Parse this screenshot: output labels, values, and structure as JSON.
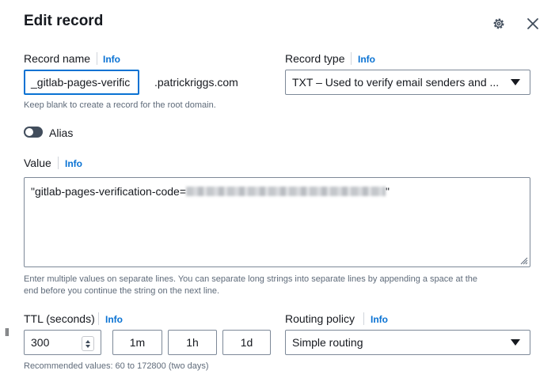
{
  "dialog": {
    "title": "Edit record",
    "settings_icon": "gear-icon",
    "close_icon": "close-icon"
  },
  "record_name": {
    "label": "Record name",
    "info": "Info",
    "value": "_gitlab-pages-verific",
    "domain_suffix": ".patrickriggs.com",
    "hint": "Keep blank to create a record for the root domain."
  },
  "record_type": {
    "label": "Record type",
    "info": "Info",
    "selected": "TXT – Used to verify email senders and ..."
  },
  "alias": {
    "label": "Alias",
    "enabled": false
  },
  "value": {
    "label": "Value",
    "info": "Info",
    "prefix": "\"gitlab-pages-verification-code=",
    "suffix": "\"",
    "hint_line1": "Enter multiple values on separate lines. You can separate long strings into separate lines by appending a space at the",
    "hint_line2": "end before you continue the string on the next line."
  },
  "ttl": {
    "label": "TTL (seconds)",
    "info": "Info",
    "value": "300",
    "presets": [
      "1m",
      "1h",
      "1d"
    ],
    "hint": "Recommended values: 60 to 172800 (two days)"
  },
  "routing_policy": {
    "label": "Routing policy",
    "info": "Info",
    "selected": "Simple routing"
  },
  "colors": {
    "accent": "#0972d3",
    "text": "#16191f",
    "hint": "#5f6b7a",
    "border": "#7d8998"
  }
}
